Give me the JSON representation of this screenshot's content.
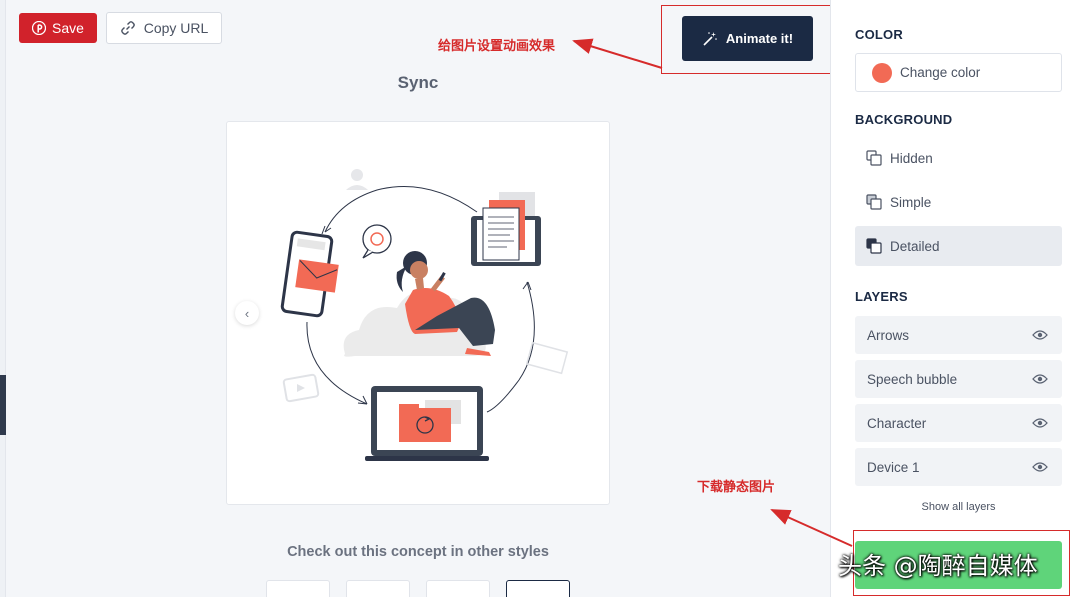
{
  "toolbar": {
    "save_label": "Save",
    "copy_label": "Copy URL",
    "animate_label": "Animate it!"
  },
  "illustration": {
    "title": "Sync"
  },
  "concept": {
    "text": "Check out this concept in other styles",
    "thumbnails": [
      "style-1",
      "style-2",
      "style-3",
      "style-4"
    ],
    "selected_index": 3
  },
  "panel": {
    "color": {
      "heading": "COLOR",
      "button_label": "Change color",
      "swatch": "#f26a55"
    },
    "background": {
      "heading": "BACKGROUND",
      "options": [
        {
          "label": "Hidden",
          "active": false
        },
        {
          "label": "Simple",
          "active": false
        },
        {
          "label": "Detailed",
          "active": true
        }
      ]
    },
    "layers": {
      "heading": "LAYERS",
      "items": [
        {
          "label": "Arrows"
        },
        {
          "label": "Speech bubble"
        },
        {
          "label": "Character"
        },
        {
          "label": "Device 1"
        }
      ],
      "show_all": "Show all layers"
    }
  },
  "annotations": {
    "top": "给图片设置动画效果",
    "bottom": "下载静态图片"
  },
  "watermark": "头条 @陶醉自媒体",
  "colors": {
    "brand_red": "#d1222b",
    "navy": "#1b2a44",
    "accent": "#f26a55",
    "download_green": "#5fd47a",
    "annotation_red": "#d62b2b"
  }
}
